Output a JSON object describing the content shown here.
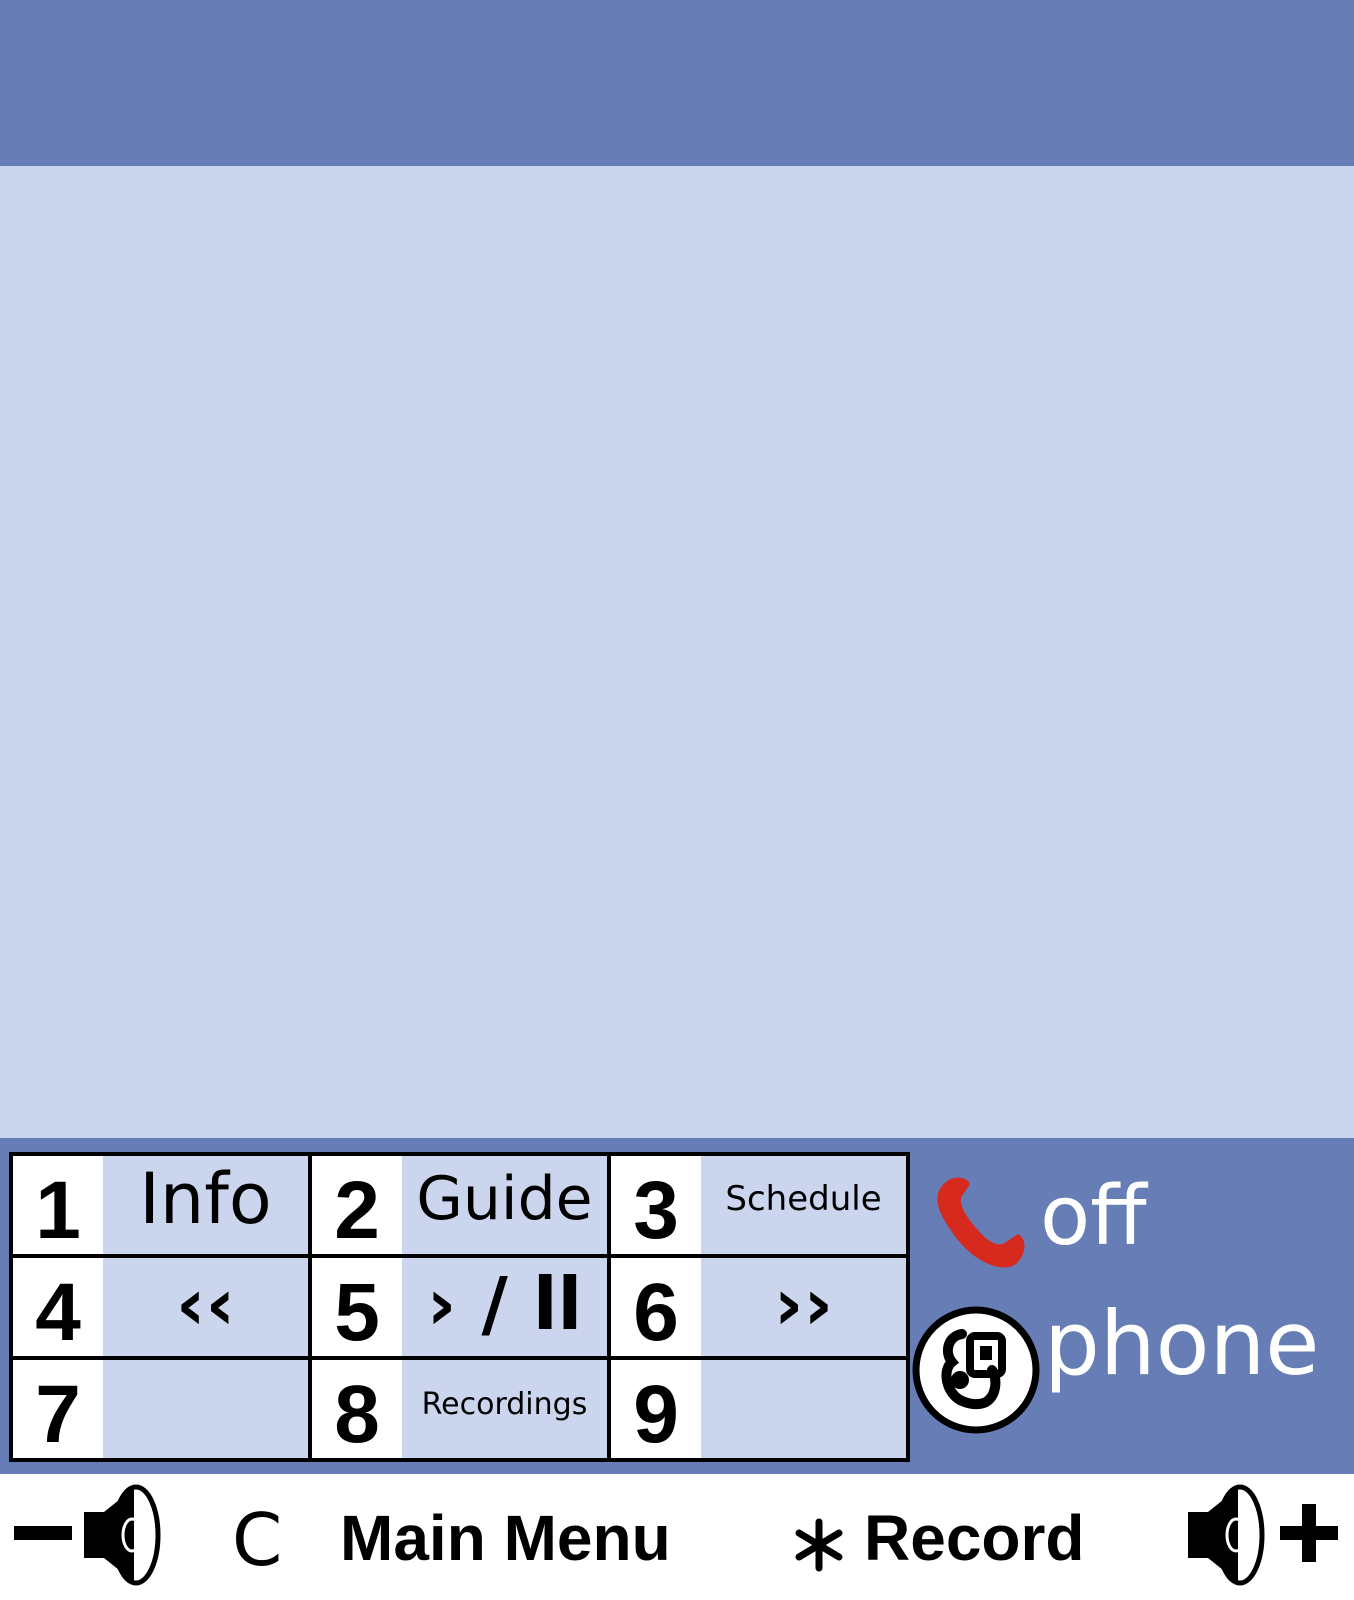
{
  "keypad": [
    {
      "num": "1",
      "label": "Info"
    },
    {
      "num": "2",
      "label": "Guide"
    },
    {
      "num": "3",
      "label": "Schedule"
    },
    {
      "num": "4",
      "label": "‹‹"
    },
    {
      "num": "5",
      "label": "› / ll"
    },
    {
      "num": "6",
      "label": "››"
    },
    {
      "num": "7",
      "label": ""
    },
    {
      "num": "8",
      "label": "Recordings"
    },
    {
      "num": "9",
      "label": ""
    }
  ],
  "status": {
    "hook_state": "off",
    "device": "phone"
  },
  "softkeys": {
    "clear_key": "C",
    "main_menu": "Main Menu",
    "record": "Record"
  },
  "icons": {
    "volume_down": "volume-down-icon",
    "volume_up": "volume-up-icon",
    "handset": "handset-icon",
    "logo": "logo-icon",
    "asterisk": "asterisk-icon"
  },
  "colors": {
    "header": "#677db5",
    "content": "#ccd5ee",
    "handset": "#d62a1e"
  }
}
